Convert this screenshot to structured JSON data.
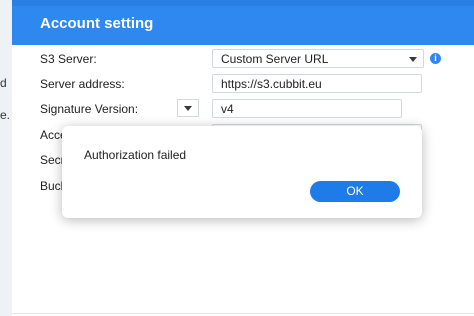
{
  "window": {
    "title": "Account setting"
  },
  "background_edge": {
    "cut_label_1": "d",
    "cut_label_2": "e."
  },
  "form": {
    "s3_server": {
      "label": "S3 Server:",
      "value": "Custom Server URL"
    },
    "server_address": {
      "label": "Server address:",
      "value": "https://s3.cubbit.eu"
    },
    "signature_version": {
      "label": "Signature Version:",
      "value": "v4"
    },
    "access_key": {
      "label": "Acce"
    },
    "secret_key": {
      "label": "Secr"
    },
    "bucket": {
      "label": "Buck"
    }
  },
  "dialog": {
    "message": "Authorization failed",
    "ok_label": "OK"
  },
  "icons": {
    "info": "info-icon",
    "dropdown": "chevron-down-icon"
  },
  "colors": {
    "accent": "#2f88f0",
    "ok_button": "#1f7be8"
  }
}
